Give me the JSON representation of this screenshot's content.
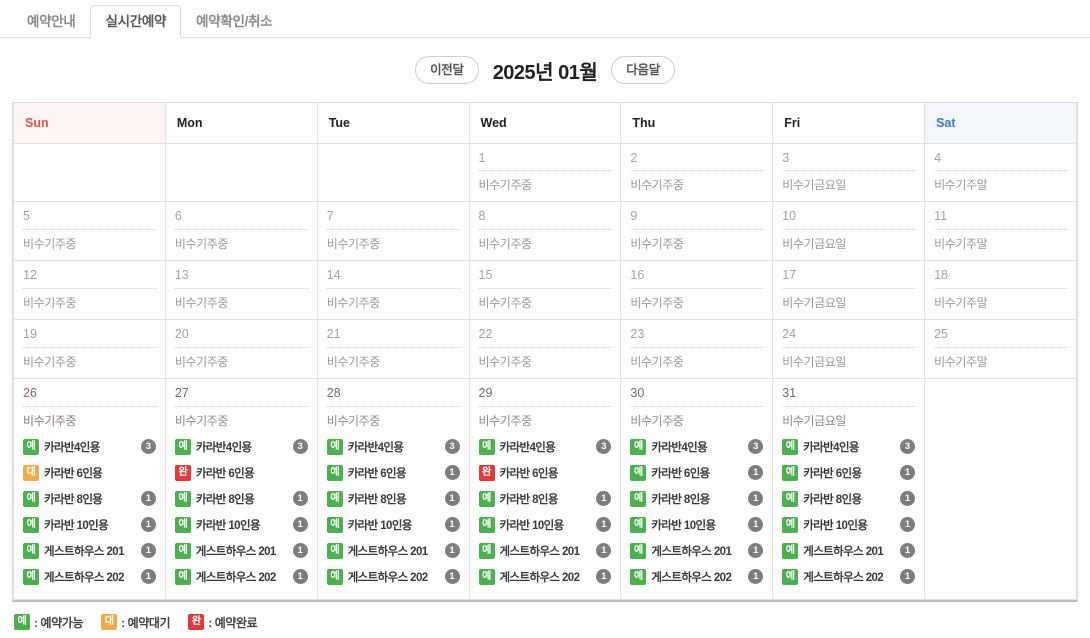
{
  "tabs": [
    {
      "label": "예약안내",
      "active": false
    },
    {
      "label": "실시간예약",
      "active": true
    },
    {
      "label": "예약확인/취소",
      "active": false
    }
  ],
  "month_nav": {
    "prev_label": "이전달",
    "next_label": "다음달",
    "current_month": "2025년 01월"
  },
  "weekday_headers": [
    "Sun",
    "Mon",
    "Tue",
    "Wed",
    "Thu",
    "Fri",
    "Sat"
  ],
  "season_labels": {
    "weekday": "비수기주중",
    "friday": "비수기금요일",
    "weekend": "비수기주말"
  },
  "status_badges": {
    "available": "예",
    "waiting": "대",
    "done": "완"
  },
  "colors": {
    "available": "#4caf50",
    "waiting": "#efab4b",
    "done": "#e03b3b",
    "count_badge": "#7d7d7d",
    "sunday_text": "#d9534f",
    "saturday_text": "#3b7bd0",
    "sunday_header_bg": "#fdf6f4",
    "saturday_header_bg": "#f3f7fc",
    "past_cell_bg": "#f5f5f5",
    "active_sunday_bg": "#f7e2e2"
  },
  "legend": [
    {
      "badge": "예",
      "status": "available",
      "text": ": 예약가능"
    },
    {
      "badge": "대",
      "status": "waiting",
      "text": ": 예약대기"
    },
    {
      "badge": "완",
      "status": "done",
      "text": ": 예약완료"
    }
  ],
  "weeks": [
    [
      {
        "empty": true
      },
      {
        "empty": true
      },
      {
        "empty": true
      },
      {
        "day": "1",
        "season": "비수기주중",
        "past": true,
        "rooms": []
      },
      {
        "day": "2",
        "season": "비수기주중",
        "past": true,
        "rooms": []
      },
      {
        "day": "3",
        "season": "비수기금요일",
        "past": true,
        "rooms": []
      },
      {
        "day": "4",
        "season": "비수기주말",
        "past": true,
        "rooms": []
      }
    ],
    [
      {
        "day": "5",
        "season": "비수기주중",
        "past": true,
        "rooms": []
      },
      {
        "day": "6",
        "season": "비수기주중",
        "past": true,
        "rooms": []
      },
      {
        "day": "7",
        "season": "비수기주중",
        "past": true,
        "rooms": []
      },
      {
        "day": "8",
        "season": "비수기주중",
        "past": true,
        "rooms": []
      },
      {
        "day": "9",
        "season": "비수기주중",
        "past": true,
        "rooms": []
      },
      {
        "day": "10",
        "season": "비수기금요일",
        "past": true,
        "rooms": []
      },
      {
        "day": "11",
        "season": "비수기주말",
        "past": true,
        "rooms": []
      }
    ],
    [
      {
        "day": "12",
        "season": "비수기주중",
        "past": true,
        "rooms": []
      },
      {
        "day": "13",
        "season": "비수기주중",
        "past": true,
        "rooms": []
      },
      {
        "day": "14",
        "season": "비수기주중",
        "past": true,
        "rooms": []
      },
      {
        "day": "15",
        "season": "비수기주중",
        "past": true,
        "rooms": []
      },
      {
        "day": "16",
        "season": "비수기주중",
        "past": true,
        "rooms": []
      },
      {
        "day": "17",
        "season": "비수기금요일",
        "past": true,
        "rooms": []
      },
      {
        "day": "18",
        "season": "비수기주말",
        "past": true,
        "rooms": []
      }
    ],
    [
      {
        "day": "19",
        "season": "비수기주중",
        "past": true,
        "rooms": []
      },
      {
        "day": "20",
        "season": "비수기주중",
        "past": true,
        "rooms": []
      },
      {
        "day": "21",
        "season": "비수기주중",
        "past": true,
        "rooms": []
      },
      {
        "day": "22",
        "season": "비수기주중",
        "past": true,
        "rooms": []
      },
      {
        "day": "23",
        "season": "비수기주중",
        "past": true,
        "rooms": []
      },
      {
        "day": "24",
        "season": "비수기금요일",
        "past": true,
        "rooms": []
      },
      {
        "day": "25",
        "season": "비수기주말",
        "past": true,
        "rooms": []
      }
    ],
    [
      {
        "day": "26",
        "season": "비수기주중",
        "past": false,
        "sunday": true,
        "rooms": [
          {
            "status": "available",
            "badge": "예",
            "name": "카라반4인용",
            "count": "3"
          },
          {
            "status": "waiting",
            "badge": "대",
            "name": "카라반 6인용",
            "count": null
          },
          {
            "status": "available",
            "badge": "예",
            "name": "카라반 8인용",
            "count": "1"
          },
          {
            "status": "available",
            "badge": "예",
            "name": "카라반 10인용",
            "count": "1"
          },
          {
            "status": "available",
            "badge": "예",
            "name": "게스트하우스 201",
            "count": "1"
          },
          {
            "status": "available",
            "badge": "예",
            "name": "게스트하우스 202",
            "count": "1"
          }
        ]
      },
      {
        "day": "27",
        "season": "비수기주중",
        "past": false,
        "rooms": [
          {
            "status": "available",
            "badge": "예",
            "name": "카라반4인용",
            "count": "3"
          },
          {
            "status": "done",
            "badge": "완",
            "name": "카라반 6인용",
            "count": null
          },
          {
            "status": "available",
            "badge": "예",
            "name": "카라반 8인용",
            "count": "1"
          },
          {
            "status": "available",
            "badge": "예",
            "name": "카라반 10인용",
            "count": "1"
          },
          {
            "status": "available",
            "badge": "예",
            "name": "게스트하우스 201",
            "count": "1"
          },
          {
            "status": "available",
            "badge": "예",
            "name": "게스트하우스 202",
            "count": "1"
          }
        ]
      },
      {
        "day": "28",
        "season": "비수기주중",
        "past": false,
        "rooms": [
          {
            "status": "available",
            "badge": "예",
            "name": "카라반4인용",
            "count": "3"
          },
          {
            "status": "available",
            "badge": "예",
            "name": "카라반 6인용",
            "count": "1"
          },
          {
            "status": "available",
            "badge": "예",
            "name": "카라반 8인용",
            "count": "1"
          },
          {
            "status": "available",
            "badge": "예",
            "name": "카라반 10인용",
            "count": "1"
          },
          {
            "status": "available",
            "badge": "예",
            "name": "게스트하우스 201",
            "count": "1"
          },
          {
            "status": "available",
            "badge": "예",
            "name": "게스트하우스 202",
            "count": "1"
          }
        ]
      },
      {
        "day": "29",
        "season": "비수기주중",
        "past": false,
        "rooms": [
          {
            "status": "available",
            "badge": "예",
            "name": "카라반4인용",
            "count": "3"
          },
          {
            "status": "done",
            "badge": "완",
            "name": "카라반 6인용",
            "count": null
          },
          {
            "status": "available",
            "badge": "예",
            "name": "카라반 8인용",
            "count": "1"
          },
          {
            "status": "available",
            "badge": "예",
            "name": "카라반 10인용",
            "count": "1"
          },
          {
            "status": "available",
            "badge": "예",
            "name": "게스트하우스 201",
            "count": "1"
          },
          {
            "status": "available",
            "badge": "예",
            "name": "게스트하우스 202",
            "count": "1"
          }
        ]
      },
      {
        "day": "30",
        "season": "비수기주중",
        "past": false,
        "rooms": [
          {
            "status": "available",
            "badge": "예",
            "name": "카라반4인용",
            "count": "3"
          },
          {
            "status": "available",
            "badge": "예",
            "name": "카라반 6인용",
            "count": "1"
          },
          {
            "status": "available",
            "badge": "예",
            "name": "카라반 8인용",
            "count": "1"
          },
          {
            "status": "available",
            "badge": "예",
            "name": "카라반 10인용",
            "count": "1"
          },
          {
            "status": "available",
            "badge": "예",
            "name": "게스트하우스 201",
            "count": "1"
          },
          {
            "status": "available",
            "badge": "예",
            "name": "게스트하우스 202",
            "count": "1"
          }
        ]
      },
      {
        "day": "31",
        "season": "비수기금요일",
        "past": false,
        "rooms": [
          {
            "status": "available",
            "badge": "예",
            "name": "카라반4인용",
            "count": "3"
          },
          {
            "status": "available",
            "badge": "예",
            "name": "카라반 6인용",
            "count": "1"
          },
          {
            "status": "available",
            "badge": "예",
            "name": "카라반 8인용",
            "count": "1"
          },
          {
            "status": "available",
            "badge": "예",
            "name": "카라반 10인용",
            "count": "1"
          },
          {
            "status": "available",
            "badge": "예",
            "name": "게스트하우스 201",
            "count": "1"
          },
          {
            "status": "available",
            "badge": "예",
            "name": "게스트하우스 202",
            "count": "1"
          }
        ]
      },
      {
        "empty": true
      }
    ]
  ]
}
